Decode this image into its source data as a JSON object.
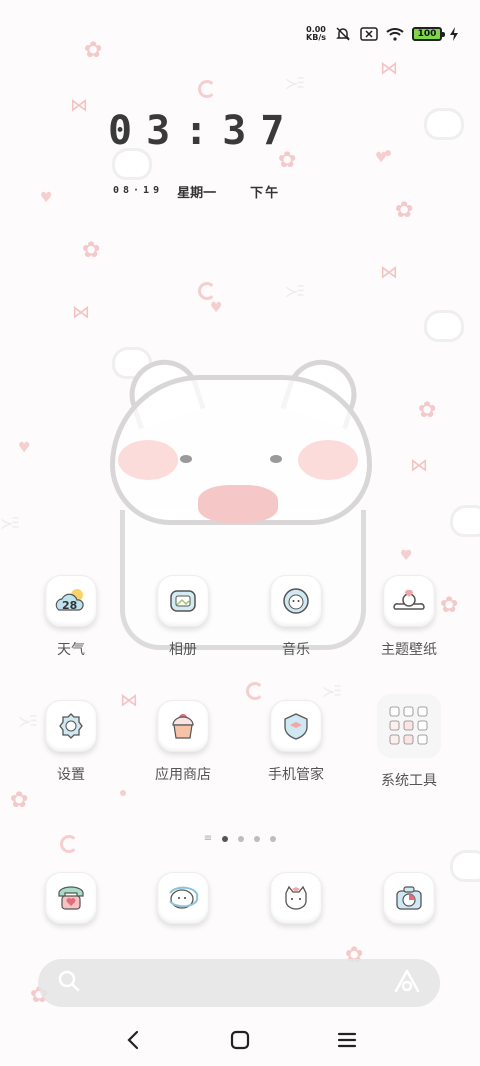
{
  "status_bar": {
    "net_speed_value": "0.00",
    "net_speed_unit": "KB/s",
    "battery_level": "100",
    "icons": [
      "bell-off-icon",
      "sim-x-icon",
      "wifi-icon",
      "battery-icon",
      "charging-icon"
    ]
  },
  "clock": {
    "time": "03:37",
    "date": "08·19",
    "weekday": "星期一",
    "ampm": "下午"
  },
  "apps": [
    {
      "label": "天气",
      "icon": "weather-icon",
      "badge": "28"
    },
    {
      "label": "相册",
      "icon": "gallery-icon"
    },
    {
      "label": "音乐",
      "icon": "music-icon"
    },
    {
      "label": "主题壁纸",
      "icon": "theme-icon"
    },
    {
      "label": "设置",
      "icon": "settings-icon"
    },
    {
      "label": "应用商店",
      "icon": "app-store-icon"
    },
    {
      "label": "手机管家",
      "icon": "phone-manager-icon"
    },
    {
      "label": "系统工具",
      "icon": "system-tools-folder-icon"
    }
  ],
  "dock": [
    {
      "icon": "phone-icon"
    },
    {
      "icon": "messages-icon"
    },
    {
      "icon": "browser-icon"
    },
    {
      "icon": "camera-icon"
    }
  ],
  "pager": {
    "pages": 4,
    "active": 0
  },
  "search": {
    "placeholder": ""
  },
  "colors": {
    "accent_pink": "#f4c2c2",
    "battery_green": "#7fd64b",
    "text": "#444444"
  }
}
